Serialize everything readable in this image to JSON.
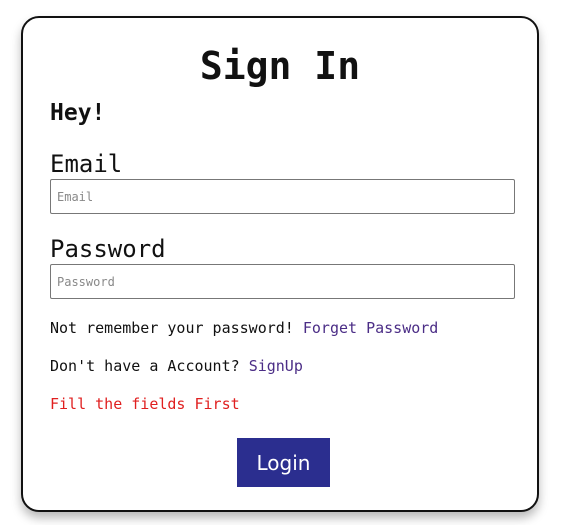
{
  "form": {
    "title": "Sign In",
    "greeting": "Hey!",
    "email": {
      "label": "Email",
      "placeholder": "Email",
      "value": ""
    },
    "password": {
      "label": "Password",
      "placeholder": "Password",
      "value": ""
    },
    "remember": {
      "text": "Not remember your password!",
      "link_label": "Forget Password"
    },
    "signup": {
      "text": "Don't have a Account?",
      "link_label": "SignUp"
    },
    "error_message": "Fill the fields First",
    "submit_label": "Login"
  },
  "colors": {
    "button": "#2b2e8f",
    "link": "#4b2d86",
    "error": "#e01f1f"
  }
}
